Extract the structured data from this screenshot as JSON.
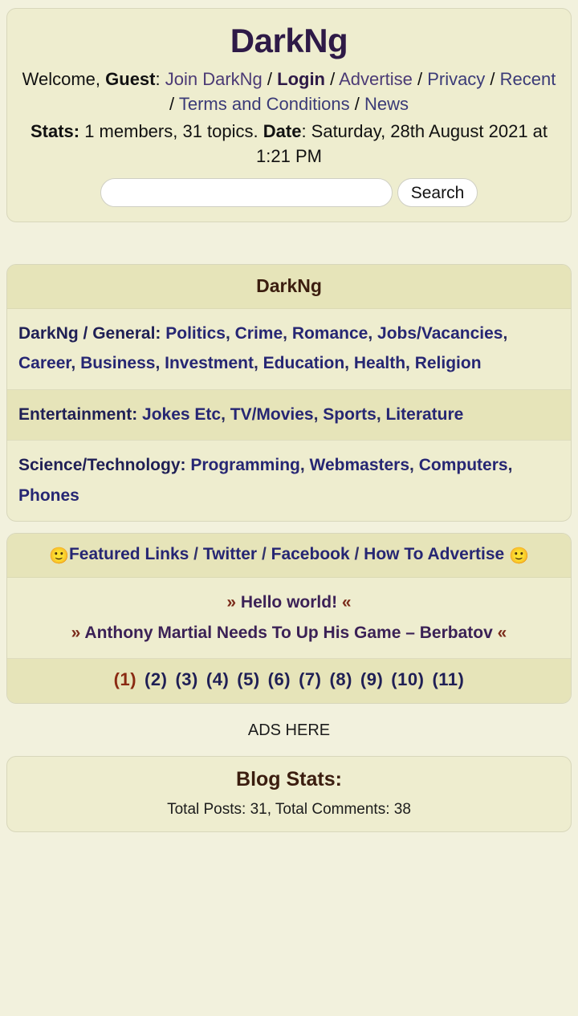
{
  "site": {
    "title": "DarkNg",
    "background_color": "#f2f1dd",
    "card_color": "#eeedcf",
    "accent_color": "#2e1a47",
    "link_color": "#262673",
    "current_page_color": "#8a2a12"
  },
  "header": {
    "title": "DarkNg",
    "welcome_prefix": "Welcome, ",
    "guest_label": "Guest",
    "after_guest": ": ",
    "links_row1": [
      {
        "label": "Join DarkNg",
        "style": "normal"
      },
      {
        "label": "Login",
        "style": "bold"
      },
      {
        "label": "Advertise",
        "style": "normal"
      }
    ],
    "links_row2": [
      {
        "label": "Privacy"
      },
      {
        "label": "Recent"
      },
      {
        "label": "Terms and Conditions"
      },
      {
        "label": "News"
      }
    ],
    "separator": " / ",
    "stats_label": "Stats:",
    "stats_value": " 1 members, 31 topics. ",
    "date_label": "Date",
    "date_value": ": Saturday, 28th August 2021 at 1:21 PM",
    "search": {
      "value": "",
      "placeholder": "",
      "button_label": "Search"
    }
  },
  "categories": {
    "heading": "DarkNg",
    "rows": [
      {
        "group": "DarkNg / General",
        "colon": ": ",
        "links": [
          "Politics",
          "Crime",
          "Romance",
          "Jobs/Vacancies",
          "Career",
          "Business",
          "Investment",
          "Education",
          "Health",
          "Religion"
        ]
      },
      {
        "group": "Entertainment",
        "colon": ": ",
        "links": [
          "Jokes Etc",
          "TV/Movies",
          "Sports",
          "Literature"
        ]
      },
      {
        "group": "Science/Technology",
        "colon": ": ",
        "links": [
          "Programming",
          "Webmasters",
          "Computers",
          "Phones"
        ]
      }
    ]
  },
  "featured": {
    "smiley": "🙂",
    "links": [
      "Featured Links",
      "Twitter",
      "Facebook",
      "How To Advertise"
    ],
    "separator": " / ",
    "trailing_smiley": "🙂"
  },
  "news": {
    "open_guillemet": "»",
    "close_guillemet": "«",
    "items": [
      "Hello world!",
      "Anthony Martial Needs To Up His Game – Berbatov"
    ]
  },
  "pagination": {
    "current": "1",
    "pages": [
      "1",
      "2",
      "3",
      "4",
      "5",
      "6",
      "7",
      "8",
      "9",
      "10",
      "11"
    ]
  },
  "ads": {
    "label": "ADS HERE"
  },
  "blog_stats": {
    "title": "Blog Stats:",
    "line": "Total Posts: 31, Total Comments: 38"
  }
}
